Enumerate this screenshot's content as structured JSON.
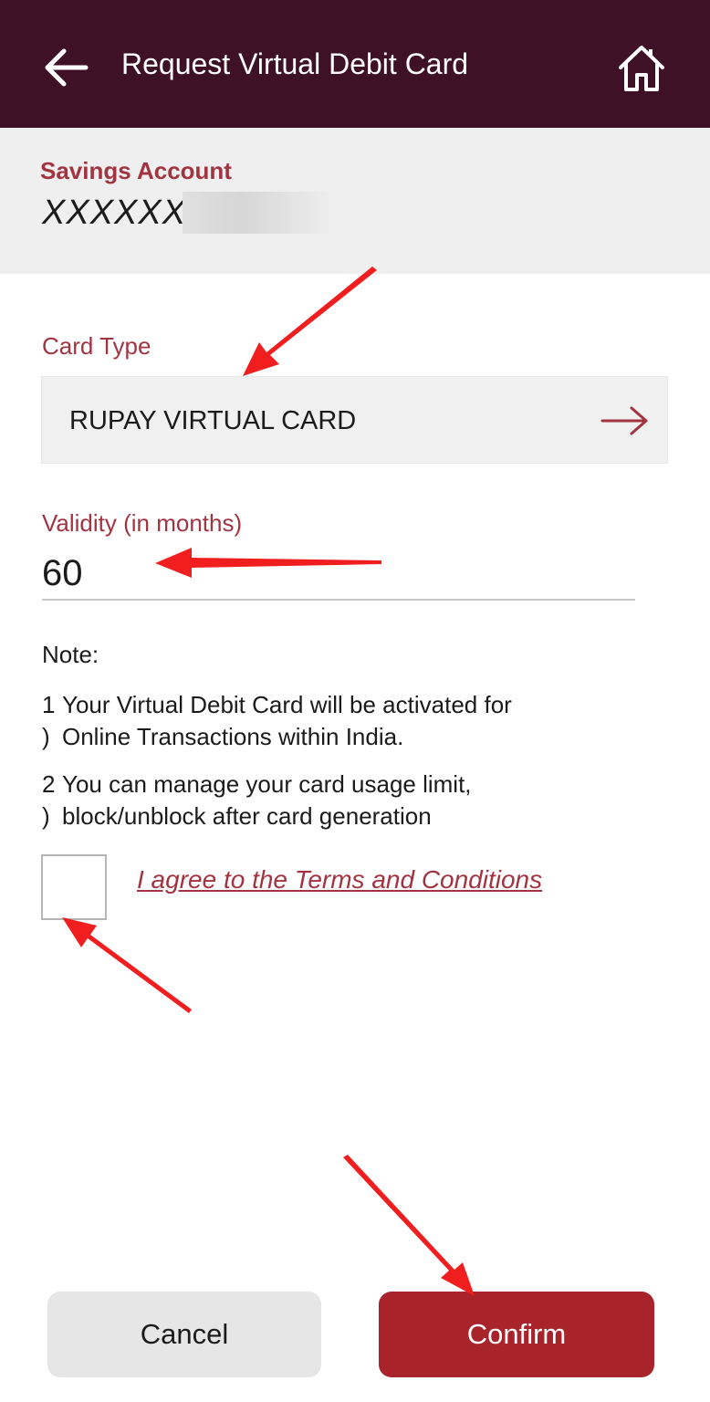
{
  "header": {
    "title": "Request Virtual Debit Card",
    "back_icon": "arrow-left-icon",
    "home_icon": "home-icon"
  },
  "account": {
    "label": "Savings Account",
    "number_visible": "XXXXXX"
  },
  "card_type": {
    "label": "Card Type",
    "value": "RUPAY VIRTUAL CARD",
    "icon": "arrow-right-icon"
  },
  "validity": {
    "label": "Validity (in months)",
    "value": "60"
  },
  "note": {
    "title": "Note:",
    "items": [
      {
        "num": "1",
        "line1": "Your Virtual Debit Card will be activated for",
        "mark": ")",
        "line2": "Online Transactions within India."
      },
      {
        "num": "2",
        "line1": "You can manage your card usage limit,",
        "mark": ")",
        "line2": "block/unblock after card generation"
      }
    ]
  },
  "terms": {
    "checked": false,
    "label": "I agree to the Terms and Conditions"
  },
  "actions": {
    "cancel_label": "Cancel",
    "confirm_label": "Confirm"
  },
  "colors": {
    "header_bg": "#3f1127",
    "accent": "#a23442",
    "confirm_bg": "#a8232a",
    "annotation_arrow": "#f01e1e"
  }
}
